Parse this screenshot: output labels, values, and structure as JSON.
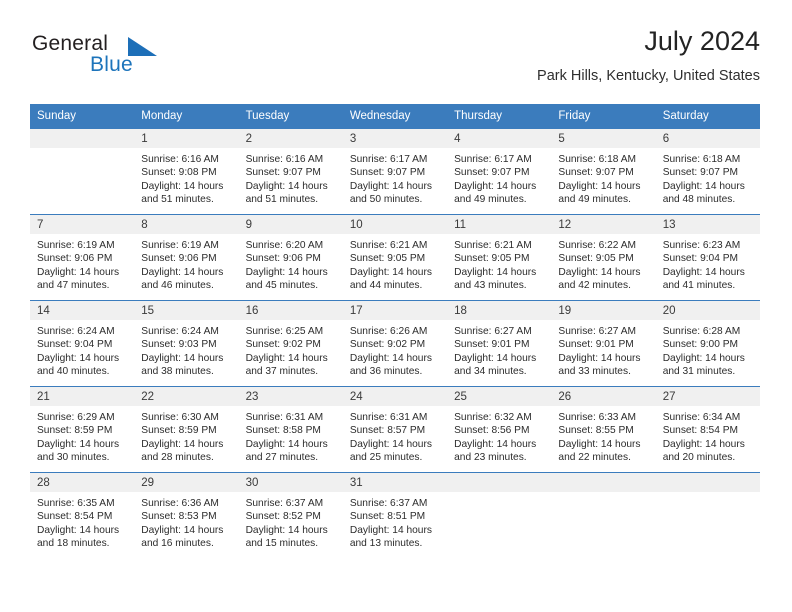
{
  "brand": {
    "line1": "General",
    "line2": "Blue",
    "triangle_color": "#1d6fb8"
  },
  "header": {
    "title": "July 2024",
    "location": "Park Hills, Kentucky, United States"
  },
  "theme": {
    "header_blue": "#3b7cbd",
    "daynum_bg": "#f0f0f0",
    "text": "#2c2c2c"
  },
  "weekday_headers": [
    "Sunday",
    "Monday",
    "Tuesday",
    "Wednesday",
    "Thursday",
    "Friday",
    "Saturday"
  ],
  "weeks": [
    [
      {
        "day": "",
        "sunrise": "",
        "sunset": "",
        "daylight_line1": "",
        "daylight_line2": ""
      },
      {
        "day": "1",
        "sunrise": "Sunrise: 6:16 AM",
        "sunset": "Sunset: 9:08 PM",
        "daylight_line1": "Daylight: 14 hours",
        "daylight_line2": "and 51 minutes."
      },
      {
        "day": "2",
        "sunrise": "Sunrise: 6:16 AM",
        "sunset": "Sunset: 9:07 PM",
        "daylight_line1": "Daylight: 14 hours",
        "daylight_line2": "and 51 minutes."
      },
      {
        "day": "3",
        "sunrise": "Sunrise: 6:17 AM",
        "sunset": "Sunset: 9:07 PM",
        "daylight_line1": "Daylight: 14 hours",
        "daylight_line2": "and 50 minutes."
      },
      {
        "day": "4",
        "sunrise": "Sunrise: 6:17 AM",
        "sunset": "Sunset: 9:07 PM",
        "daylight_line1": "Daylight: 14 hours",
        "daylight_line2": "and 49 minutes."
      },
      {
        "day": "5",
        "sunrise": "Sunrise: 6:18 AM",
        "sunset": "Sunset: 9:07 PM",
        "daylight_line1": "Daylight: 14 hours",
        "daylight_line2": "and 49 minutes."
      },
      {
        "day": "6",
        "sunrise": "Sunrise: 6:18 AM",
        "sunset": "Sunset: 9:07 PM",
        "daylight_line1": "Daylight: 14 hours",
        "daylight_line2": "and 48 minutes."
      }
    ],
    [
      {
        "day": "7",
        "sunrise": "Sunrise: 6:19 AM",
        "sunset": "Sunset: 9:06 PM",
        "daylight_line1": "Daylight: 14 hours",
        "daylight_line2": "and 47 minutes."
      },
      {
        "day": "8",
        "sunrise": "Sunrise: 6:19 AM",
        "sunset": "Sunset: 9:06 PM",
        "daylight_line1": "Daylight: 14 hours",
        "daylight_line2": "and 46 minutes."
      },
      {
        "day": "9",
        "sunrise": "Sunrise: 6:20 AM",
        "sunset": "Sunset: 9:06 PM",
        "daylight_line1": "Daylight: 14 hours",
        "daylight_line2": "and 45 minutes."
      },
      {
        "day": "10",
        "sunrise": "Sunrise: 6:21 AM",
        "sunset": "Sunset: 9:05 PM",
        "daylight_line1": "Daylight: 14 hours",
        "daylight_line2": "and 44 minutes."
      },
      {
        "day": "11",
        "sunrise": "Sunrise: 6:21 AM",
        "sunset": "Sunset: 9:05 PM",
        "daylight_line1": "Daylight: 14 hours",
        "daylight_line2": "and 43 minutes."
      },
      {
        "day": "12",
        "sunrise": "Sunrise: 6:22 AM",
        "sunset": "Sunset: 9:05 PM",
        "daylight_line1": "Daylight: 14 hours",
        "daylight_line2": "and 42 minutes."
      },
      {
        "day": "13",
        "sunrise": "Sunrise: 6:23 AM",
        "sunset": "Sunset: 9:04 PM",
        "daylight_line1": "Daylight: 14 hours",
        "daylight_line2": "and 41 minutes."
      }
    ],
    [
      {
        "day": "14",
        "sunrise": "Sunrise: 6:24 AM",
        "sunset": "Sunset: 9:04 PM",
        "daylight_line1": "Daylight: 14 hours",
        "daylight_line2": "and 40 minutes."
      },
      {
        "day": "15",
        "sunrise": "Sunrise: 6:24 AM",
        "sunset": "Sunset: 9:03 PM",
        "daylight_line1": "Daylight: 14 hours",
        "daylight_line2": "and 38 minutes."
      },
      {
        "day": "16",
        "sunrise": "Sunrise: 6:25 AM",
        "sunset": "Sunset: 9:02 PM",
        "daylight_line1": "Daylight: 14 hours",
        "daylight_line2": "and 37 minutes."
      },
      {
        "day": "17",
        "sunrise": "Sunrise: 6:26 AM",
        "sunset": "Sunset: 9:02 PM",
        "daylight_line1": "Daylight: 14 hours",
        "daylight_line2": "and 36 minutes."
      },
      {
        "day": "18",
        "sunrise": "Sunrise: 6:27 AM",
        "sunset": "Sunset: 9:01 PM",
        "daylight_line1": "Daylight: 14 hours",
        "daylight_line2": "and 34 minutes."
      },
      {
        "day": "19",
        "sunrise": "Sunrise: 6:27 AM",
        "sunset": "Sunset: 9:01 PM",
        "daylight_line1": "Daylight: 14 hours",
        "daylight_line2": "and 33 minutes."
      },
      {
        "day": "20",
        "sunrise": "Sunrise: 6:28 AM",
        "sunset": "Sunset: 9:00 PM",
        "daylight_line1": "Daylight: 14 hours",
        "daylight_line2": "and 31 minutes."
      }
    ],
    [
      {
        "day": "21",
        "sunrise": "Sunrise: 6:29 AM",
        "sunset": "Sunset: 8:59 PM",
        "daylight_line1": "Daylight: 14 hours",
        "daylight_line2": "and 30 minutes."
      },
      {
        "day": "22",
        "sunrise": "Sunrise: 6:30 AM",
        "sunset": "Sunset: 8:59 PM",
        "daylight_line1": "Daylight: 14 hours",
        "daylight_line2": "and 28 minutes."
      },
      {
        "day": "23",
        "sunrise": "Sunrise: 6:31 AM",
        "sunset": "Sunset: 8:58 PM",
        "daylight_line1": "Daylight: 14 hours",
        "daylight_line2": "and 27 minutes."
      },
      {
        "day": "24",
        "sunrise": "Sunrise: 6:31 AM",
        "sunset": "Sunset: 8:57 PM",
        "daylight_line1": "Daylight: 14 hours",
        "daylight_line2": "and 25 minutes."
      },
      {
        "day": "25",
        "sunrise": "Sunrise: 6:32 AM",
        "sunset": "Sunset: 8:56 PM",
        "daylight_line1": "Daylight: 14 hours",
        "daylight_line2": "and 23 minutes."
      },
      {
        "day": "26",
        "sunrise": "Sunrise: 6:33 AM",
        "sunset": "Sunset: 8:55 PM",
        "daylight_line1": "Daylight: 14 hours",
        "daylight_line2": "and 22 minutes."
      },
      {
        "day": "27",
        "sunrise": "Sunrise: 6:34 AM",
        "sunset": "Sunset: 8:54 PM",
        "daylight_line1": "Daylight: 14 hours",
        "daylight_line2": "and 20 minutes."
      }
    ],
    [
      {
        "day": "28",
        "sunrise": "Sunrise: 6:35 AM",
        "sunset": "Sunset: 8:54 PM",
        "daylight_line1": "Daylight: 14 hours",
        "daylight_line2": "and 18 minutes."
      },
      {
        "day": "29",
        "sunrise": "Sunrise: 6:36 AM",
        "sunset": "Sunset: 8:53 PM",
        "daylight_line1": "Daylight: 14 hours",
        "daylight_line2": "and 16 minutes."
      },
      {
        "day": "30",
        "sunrise": "Sunrise: 6:37 AM",
        "sunset": "Sunset: 8:52 PM",
        "daylight_line1": "Daylight: 14 hours",
        "daylight_line2": "and 15 minutes."
      },
      {
        "day": "31",
        "sunrise": "Sunrise: 6:37 AM",
        "sunset": "Sunset: 8:51 PM",
        "daylight_line1": "Daylight: 14 hours",
        "daylight_line2": "and 13 minutes."
      },
      {
        "day": "",
        "sunrise": "",
        "sunset": "",
        "daylight_line1": "",
        "daylight_line2": ""
      },
      {
        "day": "",
        "sunrise": "",
        "sunset": "",
        "daylight_line1": "",
        "daylight_line2": ""
      },
      {
        "day": "",
        "sunrise": "",
        "sunset": "",
        "daylight_line1": "",
        "daylight_line2": ""
      }
    ]
  ]
}
